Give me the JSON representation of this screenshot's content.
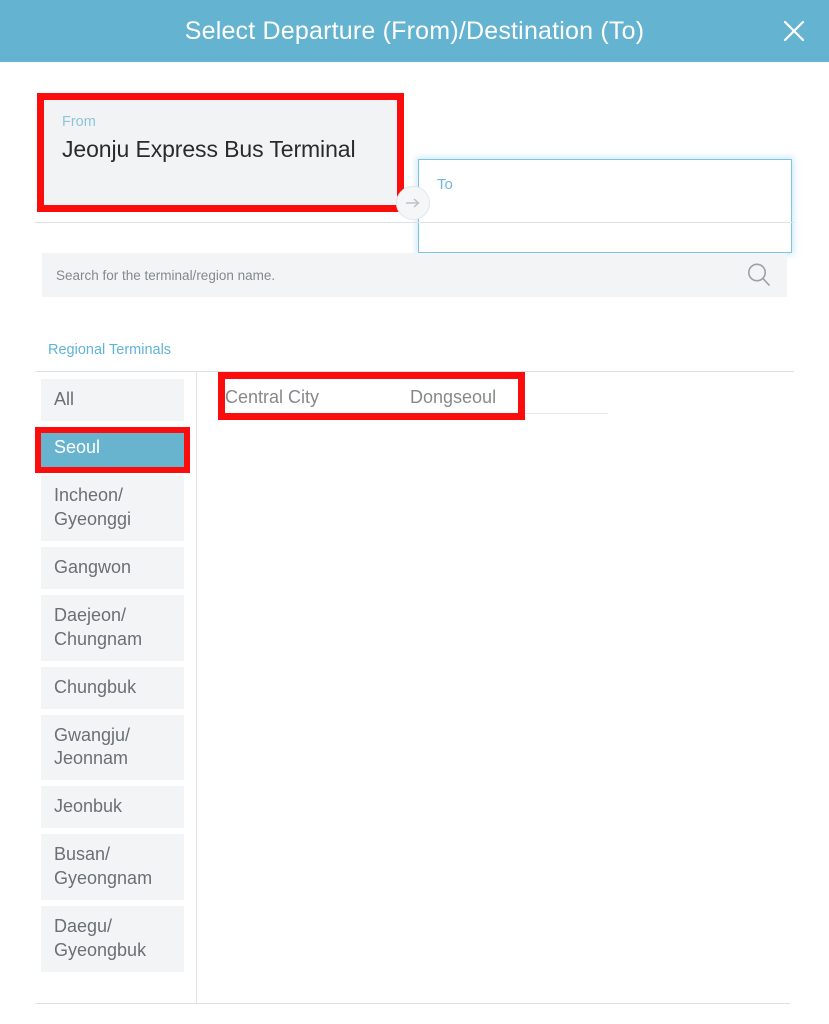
{
  "header": {
    "title": "Select Departure (From)/Destination (To)",
    "close_label": "×",
    "background_color": "#64b3d0"
  },
  "route": {
    "from": {
      "label": "From",
      "value": "Jeonju Express Bus Terminal"
    },
    "to": {
      "label": "To",
      "value": ""
    },
    "swap_icon": "arrow-right-icon"
  },
  "search": {
    "placeholder": "Search for the terminal/region name.",
    "value": "",
    "icon": "search-icon"
  },
  "tabs": [
    {
      "label": "Regional Terminals",
      "selected": true
    }
  ],
  "regions": [
    {
      "label": "All",
      "selected": false
    },
    {
      "label": "Seoul",
      "selected": true
    },
    {
      "label": "Incheon/\nGyeonggi",
      "selected": false
    },
    {
      "label": "Gangwon",
      "selected": false
    },
    {
      "label": "Daejeon/\nChungnam",
      "selected": false
    },
    {
      "label": "Chungbuk",
      "selected": false
    },
    {
      "label": "Gwangju/\nJeonnam",
      "selected": false
    },
    {
      "label": "Jeonbuk",
      "selected": false
    },
    {
      "label": "Busan/\nGyeongnam",
      "selected": false
    },
    {
      "label": "Daegu/\nGyeongbuk",
      "selected": false
    }
  ],
  "terminals": [
    {
      "name": "Central City"
    },
    {
      "name": "Dongseoul"
    }
  ],
  "annotations": {
    "highlight_color": "#fc0d0d",
    "boxes": [
      "from-field",
      "seoul-region",
      "terminal-results"
    ]
  }
}
